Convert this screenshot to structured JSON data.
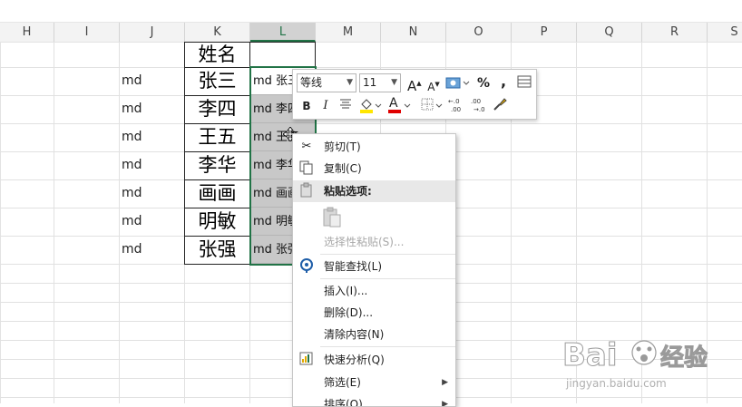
{
  "columns": [
    "H",
    "I",
    "J",
    "K",
    "L",
    "M",
    "N",
    "O",
    "P",
    "Q",
    "R",
    "S"
  ],
  "selected_column": "L",
  "header_cell": "姓名",
  "rows": [
    {
      "j": "md",
      "k": "张三",
      "l": "md 张三"
    },
    {
      "j": "md",
      "k": "李四",
      "l": "md 李四"
    },
    {
      "j": "md",
      "k": "王五",
      "l": "md 王五"
    },
    {
      "j": "md",
      "k": "李华",
      "l": "md 李华"
    },
    {
      "j": "md",
      "k": "画画",
      "l": "md 画画"
    },
    {
      "j": "md",
      "k": "明敏",
      "l": "md 明敏"
    },
    {
      "j": "md",
      "k": "张强",
      "l": "md 张强"
    }
  ],
  "mini_toolbar": {
    "font_name": "等线",
    "font_size": "11",
    "grow_font": "A",
    "shrink_font": "A",
    "percent": "%",
    "comma": ",",
    "bold": "B",
    "italic": "I",
    "font_color_letter": "A",
    "fill_color": "#ffe600",
    "font_color": "#e00000"
  },
  "context_menu": {
    "cut": "剪切(T)",
    "copy": "复制(C)",
    "paste_options": "粘贴选项:",
    "paste_special": "选择性粘贴(S)...",
    "smart_lookup": "智能查找(L)",
    "insert": "插入(I)...",
    "delete": "删除(D)...",
    "clear_contents": "清除内容(N)",
    "quick_analysis": "快速分析(Q)",
    "filter": "筛选(E)",
    "sort": "排序(O)"
  },
  "watermark": {
    "brand": "Bai",
    "brand2": "经验",
    "url": "jingyan.baidu.com"
  },
  "colors": {
    "excel_green": "#217346",
    "selection_fill": "#c8c8c8"
  }
}
